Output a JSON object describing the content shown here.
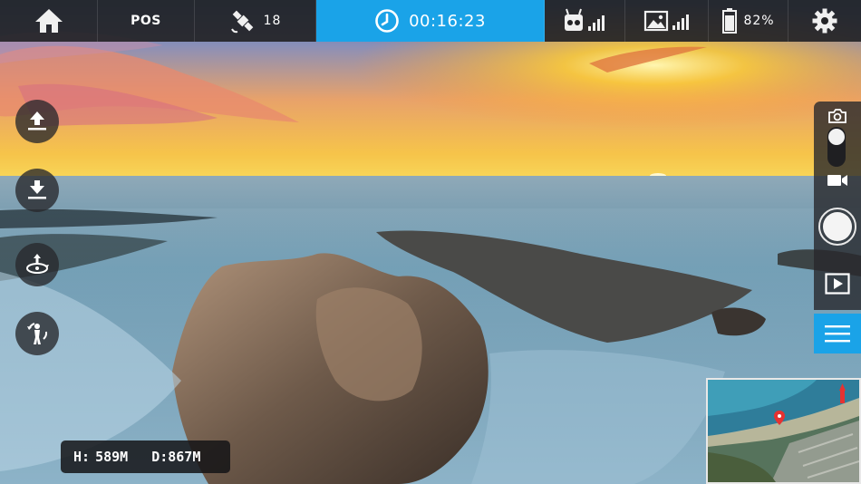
{
  "status_bar": {
    "mode_label": "POS",
    "gps_satellites": "18",
    "flight_timer": "00:16:23",
    "battery_percent": "82%"
  },
  "telemetry": {
    "height_label": "H:",
    "height_value": "589M",
    "distance_label": "D:",
    "distance_value": "867M"
  },
  "colors": {
    "accent": "#1aa3e8",
    "bar_background": "#232326"
  },
  "icons": {
    "home": "home-icon",
    "gps": "satellite-icon",
    "timer": "clock-icon",
    "remote": "remote-controller-signal-icon",
    "image": "image-transmission-signal-icon",
    "battery": "battery-icon",
    "settings": "gear-icon",
    "takeoff": "auto-takeoff-icon",
    "land": "auto-land-icon",
    "orbit": "orbit-icon",
    "return": "return-home-icon",
    "photo": "camera-icon",
    "video": "video-icon",
    "playback": "playback-icon",
    "menu": "menu-icon",
    "map_marker": "map-marker-icon"
  }
}
